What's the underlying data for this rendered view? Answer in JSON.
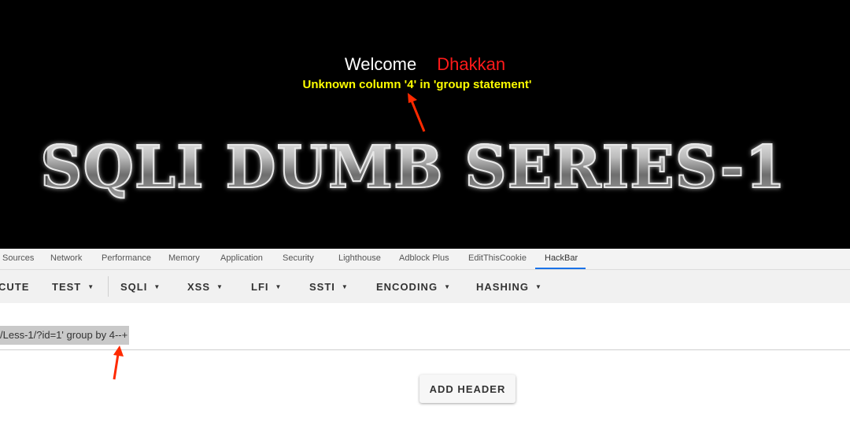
{
  "page": {
    "welcome_label": "Welcome",
    "welcome_user": "Dhakkan",
    "error_message": "Unknown column '4' in 'group statement'",
    "banner_title": "SQLI DUMB SERIES-1"
  },
  "devtools_tabs": [
    {
      "label": "Sources"
    },
    {
      "label": "Network"
    },
    {
      "label": "Performance"
    },
    {
      "label": "Memory"
    },
    {
      "label": "Application"
    },
    {
      "label": "Security"
    },
    {
      "label": "Lighthouse"
    },
    {
      "label": "Adblock Plus"
    },
    {
      "label": "EditThisCookie"
    },
    {
      "label": "HackBar",
      "active": true
    }
  ],
  "hackbar_menu": [
    {
      "label": "CUTE"
    },
    {
      "label": "TEST"
    },
    {
      "label": "SQLI"
    },
    {
      "label": "XSS"
    },
    {
      "label": "LFI"
    },
    {
      "label": "SSTI"
    },
    {
      "label": "ENCODING"
    },
    {
      "label": "HASHING"
    }
  ],
  "url_input": {
    "value": "/Less-1/?id=1' group by 4--+"
  },
  "buttons": {
    "add_header": "ADD HEADER"
  },
  "colors": {
    "page_bg": "#000000",
    "welcome_user": "#ff1a1a",
    "error_text": "#ffff00",
    "active_tab_underline": "#1a73e8",
    "annotation_arrow": "#ff2a00"
  },
  "icons": {
    "dropdown": "caret-down-icon",
    "annotation": "red-arrow-icon"
  }
}
